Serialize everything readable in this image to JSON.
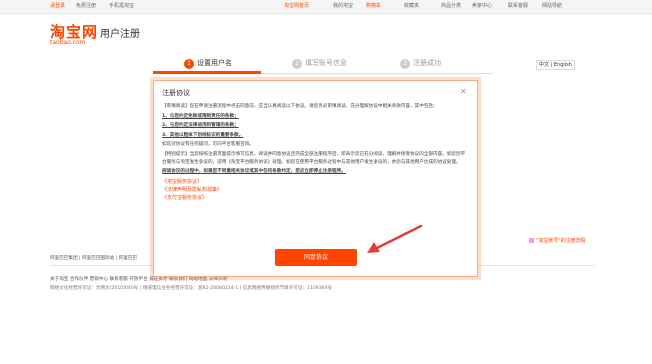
{
  "topbar": {
    "login": "请登录",
    "register": "免费注册",
    "mobile": "手机逛淘宝",
    "home": "淘宝网首页",
    "my_taobao": "我的淘宝",
    "cart": "购物车",
    "favorites": "收藏夹",
    "categories": "商品分类",
    "seller_center": "卖家中心",
    "service": "联系客服",
    "sitemap": "网站导航"
  },
  "header": {
    "logo_cn": "淘宝网",
    "logo_en": "taobao.com",
    "page_title": "用户注册",
    "language": "中文 | English"
  },
  "steps": [
    {
      "num": "1",
      "label": "设置用户名"
    },
    {
      "num": "2",
      "label": "填写账号信息"
    },
    {
      "num": "3",
      "label": "注册成功"
    }
  ],
  "dialog": {
    "title": "注册协议",
    "close": "✕",
    "para1": "【审慎阅读】您在申请注册流程中点击同意前，应当认真阅读以下协议。请您务必审慎阅读、充分理解协议中相关条款内容，其中包括：",
    "item1": "1、与您约定免除或限制责任的条款；",
    "item2": "2、与您约定法律适用和管辖的条款；",
    "item3": "3、其他以粗体下划线标识的重要条款。",
    "para2": "如您对协议有任何疑问，可向平台客服咨询。",
    "para3": "【特别提示】当您按照注册页面提示填写信息、阅读并同意协议且完成全部注册程序后，即表示您已充分阅读、理解并接受协议的全部内容。如您因平台服务与淘宝发生争议的，适用《淘宝平台服务协议》处理。如您在使用平台服务过程中与其他用户发生争议的，依您与其他用户达成的协议处理。",
    "para4": "阅读协议的过程中，如果您不同意相关协议或其中任何条款约定，您应立即停止注册程序。",
    "link1": "《淘宝服务协议》",
    "link2": "《法律声明及隐私权政策》",
    "link3": "《支付宝服务协议》",
    "agree_button": "同意协议"
  },
  "side_note": "\"淘宝账号\"的注册流程",
  "footer": {
    "links": "阿里巴巴集团 | 阿里巴巴国际站 | 阿里巴巴",
    "nav": "关于淘宝  合作伙伴  营销中心  联系客服  开放平台  诚征英才  联系我们  网站地图  法律声明",
    "icp": "网络文化经营许可证：文网文[2010]040号  |  增值电信业务经营许可证：浙B2-20080224-1  |  信息网络传播视听节目许可证：1109364号"
  },
  "colors": {
    "accent": "#ff4400"
  }
}
